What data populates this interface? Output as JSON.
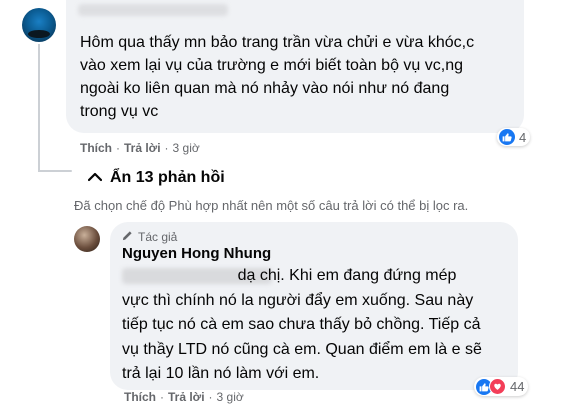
{
  "comment": {
    "text": "Hôm qua thấy mn bảo trang trần vừa chửi e vừa khóc,c\nvào xem lại vụ của trường e mới biết toàn bộ vụ vc,ng\nngoài ko liên quan mà nó nhảy vào nói như nó đang\ntrong vụ vc",
    "like_label": "Thích",
    "reply_label": "Trả lời",
    "separator": "·",
    "time": "3 giờ",
    "reaction_count": "4",
    "reaction_icons": [
      "like-icon"
    ]
  },
  "replies_toggle": {
    "label": "Ẩn 13 phản hồi",
    "icon": "chevron-up-icon"
  },
  "filter_note": "Đã chọn chế độ Phù hợp nhất nên một số câu trả lời có thể bị lọc ra.",
  "reply": {
    "badge": "Tác giả",
    "badge_icon": "pen-icon",
    "author": "Nguyen Hong Nhung",
    "text": "                          dạ chị. Khi em đang đứng mép\nvực thì chính nó la người đẩy em xuống. Sau này\ntiếp tục nó cà em sao chưa thấy bỏ chồng. Tiếp cả\nvụ thầy LTD nó cũng cà em. Quan điểm em là e sẽ\ntrả lại 10 lần nó làm với em.",
    "like_label": "Thích",
    "reply_label": "Trả lời",
    "separator": "·",
    "time": "3 giờ",
    "reaction_count": "44",
    "reaction_icons": [
      "like-icon",
      "love-icon"
    ]
  },
  "colors": {
    "bubble": "#f0f2f5",
    "like": "#1877f2",
    "love": "#f33e58",
    "meta": "#65676b"
  }
}
